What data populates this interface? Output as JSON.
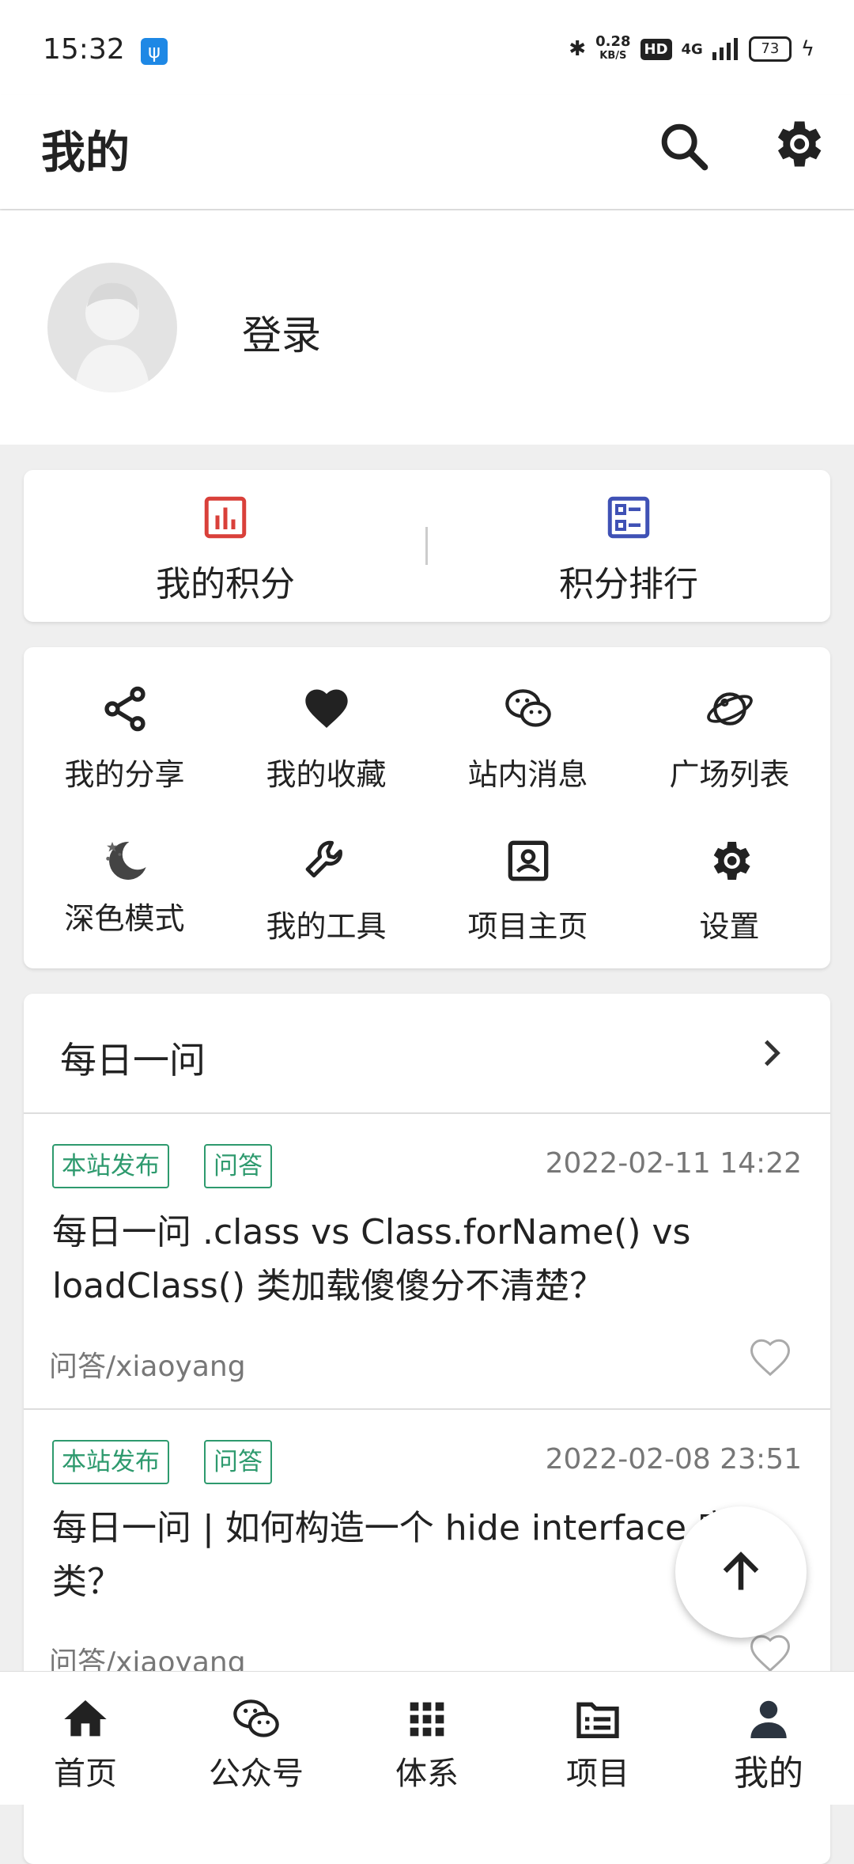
{
  "status_bar": {
    "time": "15:32",
    "usb_icon": "usb-icon",
    "net_speed_value": "0.28",
    "net_speed_unit": "KB/S",
    "hd": "HD",
    "network": "4G",
    "battery": "73"
  },
  "app_bar": {
    "title": "我的",
    "search_icon": "search-icon",
    "settings_icon": "gear-icon"
  },
  "profile": {
    "login_label": "登录"
  },
  "points": [
    {
      "label": "我的积分",
      "icon": "bar-chart-icon",
      "color": "#d9403a"
    },
    {
      "label": "积分排行",
      "icon": "list-grid-icon",
      "color": "#3f51b5"
    }
  ],
  "menu": [
    {
      "label": "我的分享",
      "icon": "share-icon"
    },
    {
      "label": "我的收藏",
      "icon": "heart-icon"
    },
    {
      "label": "站内消息",
      "icon": "wechat-icon"
    },
    {
      "label": "广场列表",
      "icon": "planet-icon"
    },
    {
      "label": "深色模式",
      "icon": "moon-icon"
    },
    {
      "label": "我的工具",
      "icon": "wrench-icon"
    },
    {
      "label": "项目主页",
      "icon": "contact-icon"
    },
    {
      "label": "设置",
      "icon": "gear-icon"
    }
  ],
  "qa": {
    "title": "每日一问",
    "articles": [
      {
        "tags": [
          "本站发布",
          "问答"
        ],
        "date": "2022-02-11 14:22",
        "title": "每日一问 .class vs Class.forName() vs loadClass() 类加载傻傻分不清楚？",
        "meta": "问答/xiaoyang"
      },
      {
        "tags": [
          "本站发布",
          "问答"
        ],
        "date": "2022-02-08 23:51",
        "title": "每日一问 | 如何构造一个 hide interface 实现类？",
        "meta": "问答/xiaoyang"
      }
    ]
  },
  "bottom_nav": [
    {
      "label": "首页",
      "icon": "home-icon"
    },
    {
      "label": "公众号",
      "icon": "wechat-icon"
    },
    {
      "label": "体系",
      "icon": "grid-icon"
    },
    {
      "label": "项目",
      "icon": "folder-list-icon"
    },
    {
      "label": "我的",
      "icon": "person-icon",
      "active": true
    }
  ],
  "colors": {
    "accent_green": "#2e9a6e",
    "points_red": "#d9403a",
    "points_blue": "#3f51b5"
  }
}
